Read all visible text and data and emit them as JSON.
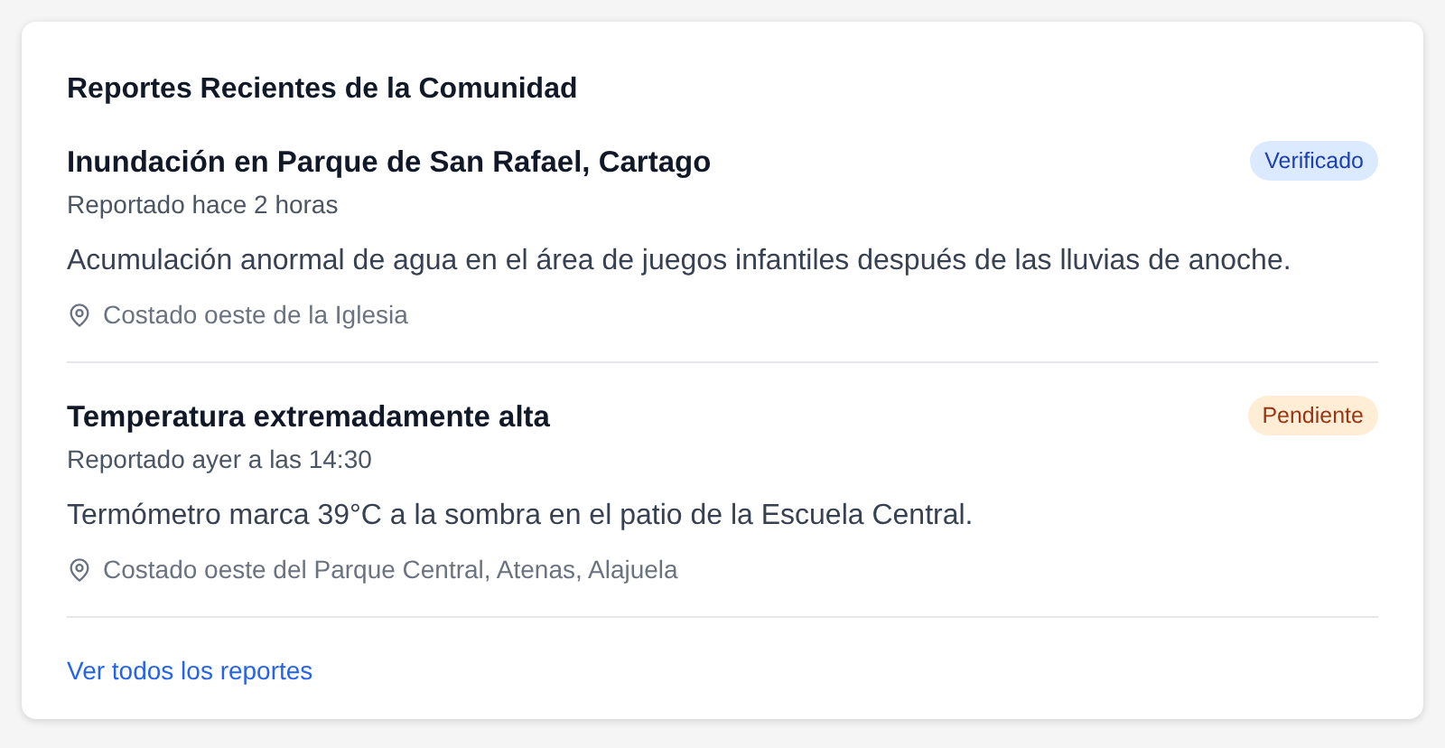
{
  "card": {
    "title": "Reportes Recientes de la Comunidad",
    "reports": [
      {
        "title": "Inundación en Parque de San Rafael, Cartago",
        "time": "Reportado hace 2 horas",
        "status": {
          "label": "Verificado",
          "kind": "verified"
        },
        "description": "Acumulación anormal de agua en el área de juegos infantiles después de las lluvias de anoche.",
        "location": "Costado oeste de la Iglesia"
      },
      {
        "title": "Temperatura extremadamente alta",
        "time": "Reportado ayer a las 14:30",
        "status": {
          "label": "Pendiente",
          "kind": "pending"
        },
        "description": "Termómetro marca 39°C a la sombra en el patio de la Escuela Central.",
        "location": "Costado oeste del Parque Central, Atenas, Alajuela"
      }
    ],
    "link": "Ver todos los reportes"
  }
}
